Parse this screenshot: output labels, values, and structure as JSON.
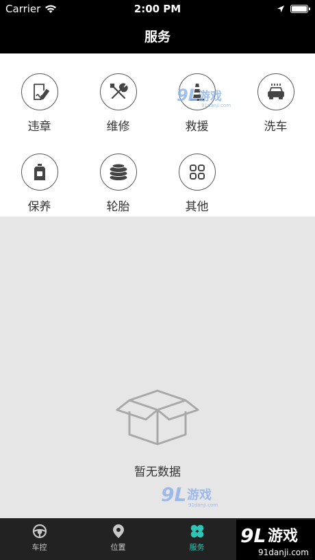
{
  "status": {
    "carrier": "Carrier",
    "time": "2:00 PM"
  },
  "header": {
    "title": "服务"
  },
  "services": [
    {
      "label": "违章",
      "icon": "violation-icon"
    },
    {
      "label": "维修",
      "icon": "repair-tools-icon"
    },
    {
      "label": "救援",
      "icon": "traffic-cone-icon"
    },
    {
      "label": "洗车",
      "icon": "car-wash-icon"
    },
    {
      "label": "保养",
      "icon": "oil-can-icon"
    },
    {
      "label": "轮胎",
      "icon": "tire-icon"
    },
    {
      "label": "其他",
      "icon": "grid-icon"
    }
  ],
  "empty": {
    "text": "暂无数据"
  },
  "tabs": [
    {
      "label": "车控",
      "icon": "steering-wheel-icon"
    },
    {
      "label": "位置",
      "icon": "location-pin-icon"
    },
    {
      "label": "服务",
      "icon": "clover-icon",
      "active": true
    },
    {
      "label": "",
      "icon": ""
    }
  ],
  "watermark": {
    "brand": "9L游戏",
    "site": "91danji.com"
  },
  "colors": {
    "accent": "#2ec4b6",
    "tabbar": "#222222",
    "header": "#000000"
  }
}
